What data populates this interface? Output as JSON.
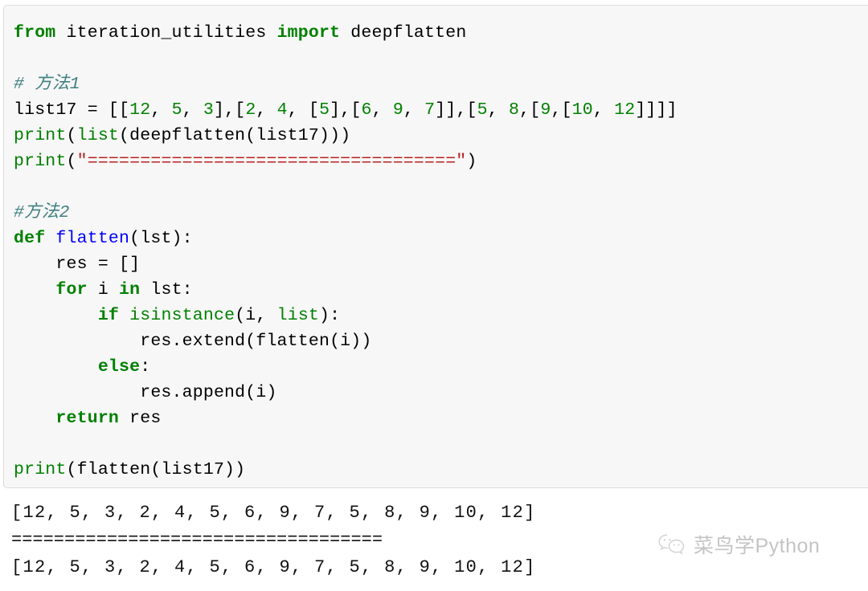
{
  "code_block": {
    "language": "python",
    "background": "#f7f7f7",
    "border_color": "#dcdcdc",
    "lines": [
      {
        "id": "line-import",
        "tokens": [
          {
            "t": "from",
            "c": "k"
          },
          {
            "t": " iteration_utilities ",
            "c": "p"
          },
          {
            "t": "import",
            "c": "k"
          },
          {
            "t": " deepflatten",
            "c": "p"
          }
        ]
      },
      {
        "id": "line-blank-1",
        "tokens": [
          {
            "t": " ",
            "c": "p"
          }
        ]
      },
      {
        "id": "line-comment-method1",
        "tokens": [
          {
            "t": "# 方法1",
            "c": "c"
          }
        ]
      },
      {
        "id": "line-list17",
        "tokens": [
          {
            "t": "list17 = [[",
            "c": "p"
          },
          {
            "t": "12",
            "c": "mi"
          },
          {
            "t": ", ",
            "c": "p"
          },
          {
            "t": "5",
            "c": "mi"
          },
          {
            "t": ", ",
            "c": "p"
          },
          {
            "t": "3",
            "c": "mi"
          },
          {
            "t": "],[",
            "c": "p"
          },
          {
            "t": "2",
            "c": "mi"
          },
          {
            "t": ", ",
            "c": "p"
          },
          {
            "t": "4",
            "c": "mi"
          },
          {
            "t": ", [",
            "c": "p"
          },
          {
            "t": "5",
            "c": "mi"
          },
          {
            "t": "],[",
            "c": "p"
          },
          {
            "t": "6",
            "c": "mi"
          },
          {
            "t": ", ",
            "c": "p"
          },
          {
            "t": "9",
            "c": "mi"
          },
          {
            "t": ", ",
            "c": "p"
          },
          {
            "t": "7",
            "c": "mi"
          },
          {
            "t": "]],[",
            "c": "p"
          },
          {
            "t": "5",
            "c": "mi"
          },
          {
            "t": ", ",
            "c": "p"
          },
          {
            "t": "8",
            "c": "mi"
          },
          {
            "t": ",[",
            "c": "p"
          },
          {
            "t": "9",
            "c": "mi"
          },
          {
            "t": ",[",
            "c": "p"
          },
          {
            "t": "10",
            "c": "mi"
          },
          {
            "t": ", ",
            "c": "p"
          },
          {
            "t": "12",
            "c": "mi"
          },
          {
            "t": "]]]]",
            "c": "p"
          }
        ]
      },
      {
        "id": "line-print-deepflatten",
        "tokens": [
          {
            "t": "print",
            "c": "nb"
          },
          {
            "t": "(",
            "c": "p"
          },
          {
            "t": "list",
            "c": "nb"
          },
          {
            "t": "(deepflatten(list17)))",
            "c": "p"
          }
        ]
      },
      {
        "id": "line-print-separator",
        "tokens": [
          {
            "t": "print",
            "c": "nb"
          },
          {
            "t": "(",
            "c": "p"
          },
          {
            "t": "\"===================================\"",
            "c": "s"
          },
          {
            "t": ")",
            "c": "p"
          }
        ]
      },
      {
        "id": "line-blank-2",
        "tokens": [
          {
            "t": " ",
            "c": "p"
          }
        ]
      },
      {
        "id": "line-comment-method2",
        "tokens": [
          {
            "t": "#方法2",
            "c": "c"
          }
        ]
      },
      {
        "id": "line-def-flatten",
        "tokens": [
          {
            "t": "def",
            "c": "k"
          },
          {
            "t": " ",
            "c": "p"
          },
          {
            "t": "flatten",
            "c": "nf"
          },
          {
            "t": "(lst):",
            "c": "p"
          }
        ]
      },
      {
        "id": "line-res-init",
        "tokens": [
          {
            "t": "    res = []",
            "c": "p"
          }
        ]
      },
      {
        "id": "line-for-loop",
        "tokens": [
          {
            "t": "    ",
            "c": "p"
          },
          {
            "t": "for",
            "c": "k"
          },
          {
            "t": " i ",
            "c": "p"
          },
          {
            "t": "in",
            "c": "k"
          },
          {
            "t": " lst:",
            "c": "p"
          }
        ]
      },
      {
        "id": "line-if-isinstance",
        "tokens": [
          {
            "t": "        ",
            "c": "p"
          },
          {
            "t": "if",
            "c": "k"
          },
          {
            "t": " ",
            "c": "p"
          },
          {
            "t": "isinstance",
            "c": "nb"
          },
          {
            "t": "(i, ",
            "c": "p"
          },
          {
            "t": "list",
            "c": "nb"
          },
          {
            "t": "):",
            "c": "p"
          }
        ]
      },
      {
        "id": "line-res-extend",
        "tokens": [
          {
            "t": "            res.extend(flatten(i))",
            "c": "p"
          }
        ]
      },
      {
        "id": "line-else",
        "tokens": [
          {
            "t": "        ",
            "c": "p"
          },
          {
            "t": "else",
            "c": "k"
          },
          {
            "t": ":",
            "c": "p"
          }
        ]
      },
      {
        "id": "line-res-append",
        "tokens": [
          {
            "t": "            res.append(i)",
            "c": "p"
          }
        ]
      },
      {
        "id": "line-return",
        "tokens": [
          {
            "t": "    ",
            "c": "p"
          },
          {
            "t": "return",
            "c": "k"
          },
          {
            "t": " res",
            "c": "p"
          }
        ]
      },
      {
        "id": "line-blank-3",
        "tokens": [
          {
            "t": " ",
            "c": "p"
          }
        ]
      },
      {
        "id": "line-print-flatten",
        "tokens": [
          {
            "t": "print",
            "c": "nb"
          },
          {
            "t": "(flatten(list17))",
            "c": "p"
          }
        ]
      }
    ]
  },
  "output": {
    "lines": [
      {
        "id": "output-line-1",
        "text": "[12, 5, 3, 2, 4, 5, 6, 9, 7, 5, 8, 9, 10, 12]",
        "kind": "result"
      },
      {
        "id": "output-line-separator",
        "text": "===================================",
        "kind": "separator"
      },
      {
        "id": "output-line-2",
        "text": "[12, 5, 3, 2, 4, 5, 6, 9, 7, 5, 8, 9, 10, 12]",
        "kind": "result"
      }
    ]
  },
  "watermark": {
    "icon": "wechat-logo-icon",
    "text": "菜鸟学Python",
    "color": "#9a9a9a"
  }
}
